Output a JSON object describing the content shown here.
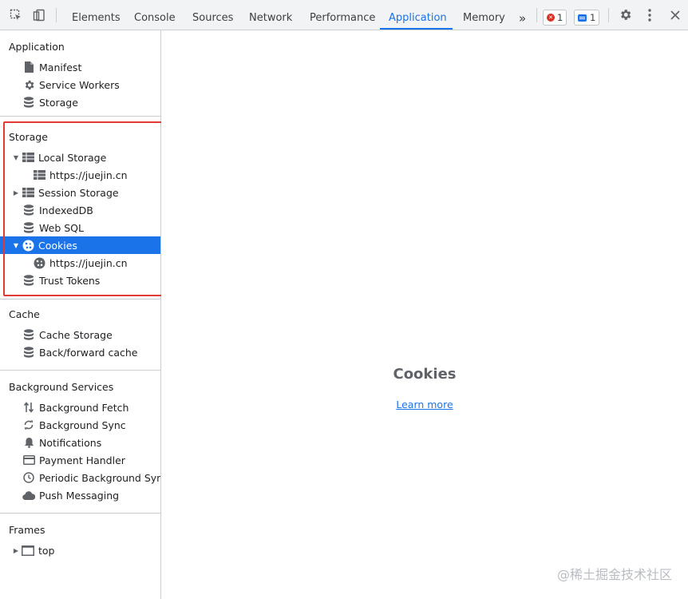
{
  "toolbar": {
    "tabs": [
      "Elements",
      "Console",
      "Sources",
      "Network",
      "Performance",
      "Application",
      "Memory"
    ],
    "active_tab": "Application",
    "overflow_label": "»",
    "error_count": "1",
    "message_count": "1",
    "inspect_icon": "inspect-element-icon",
    "device_icon": "device-toolbar-icon",
    "settings_icon": "gear-icon",
    "menu_icon": "kebab-menu-icon",
    "close_icon": "close-icon",
    "accent_color": "#1a73e8",
    "error_color": "#d93025"
  },
  "sidebar": {
    "application": {
      "title": "Application",
      "items": [
        {
          "label": "Manifest",
          "icon": "file-icon"
        },
        {
          "label": "Service Workers",
          "icon": "gear-icon"
        },
        {
          "label": "Storage",
          "icon": "database-icon"
        }
      ]
    },
    "storage": {
      "title": "Storage",
      "items": [
        {
          "label": "Local Storage",
          "icon": "table-icon",
          "expanded": true
        },
        {
          "label": "https://juejin.cn",
          "icon": "table-icon"
        },
        {
          "label": "Session Storage",
          "icon": "table-icon",
          "expanded": false
        },
        {
          "label": "IndexedDB",
          "icon": "database-icon"
        },
        {
          "label": "Web SQL",
          "icon": "database-icon"
        },
        {
          "label": "Cookies",
          "icon": "cookie-icon",
          "expanded": true,
          "selected": true
        },
        {
          "label": "https://juejin.cn",
          "icon": "cookie-icon"
        },
        {
          "label": "Trust Tokens",
          "icon": "database-icon"
        }
      ]
    },
    "cache": {
      "title": "Cache",
      "items": [
        {
          "label": "Cache Storage",
          "icon": "database-icon"
        },
        {
          "label": "Back/forward cache",
          "icon": "database-icon"
        }
      ]
    },
    "background_services": {
      "title": "Background Services",
      "items": [
        {
          "label": "Background Fetch",
          "icon": "up-down-arrows-icon"
        },
        {
          "label": "Background Sync",
          "icon": "sync-icon"
        },
        {
          "label": "Notifications",
          "icon": "bell-icon"
        },
        {
          "label": "Payment Handler",
          "icon": "credit-card-icon"
        },
        {
          "label": "Periodic Background Sync",
          "icon": "clock-icon"
        },
        {
          "label": "Push Messaging",
          "icon": "cloud-icon"
        }
      ]
    },
    "frames": {
      "title": "Frames",
      "items": [
        {
          "label": "top",
          "icon": "frame-icon",
          "expanded": false
        }
      ]
    },
    "selected_color": "#1a73e8",
    "highlight_color": "#e53935"
  },
  "main": {
    "title": "Cookies",
    "link": "Learn more",
    "watermark": "@稀土掘金技术社区"
  }
}
